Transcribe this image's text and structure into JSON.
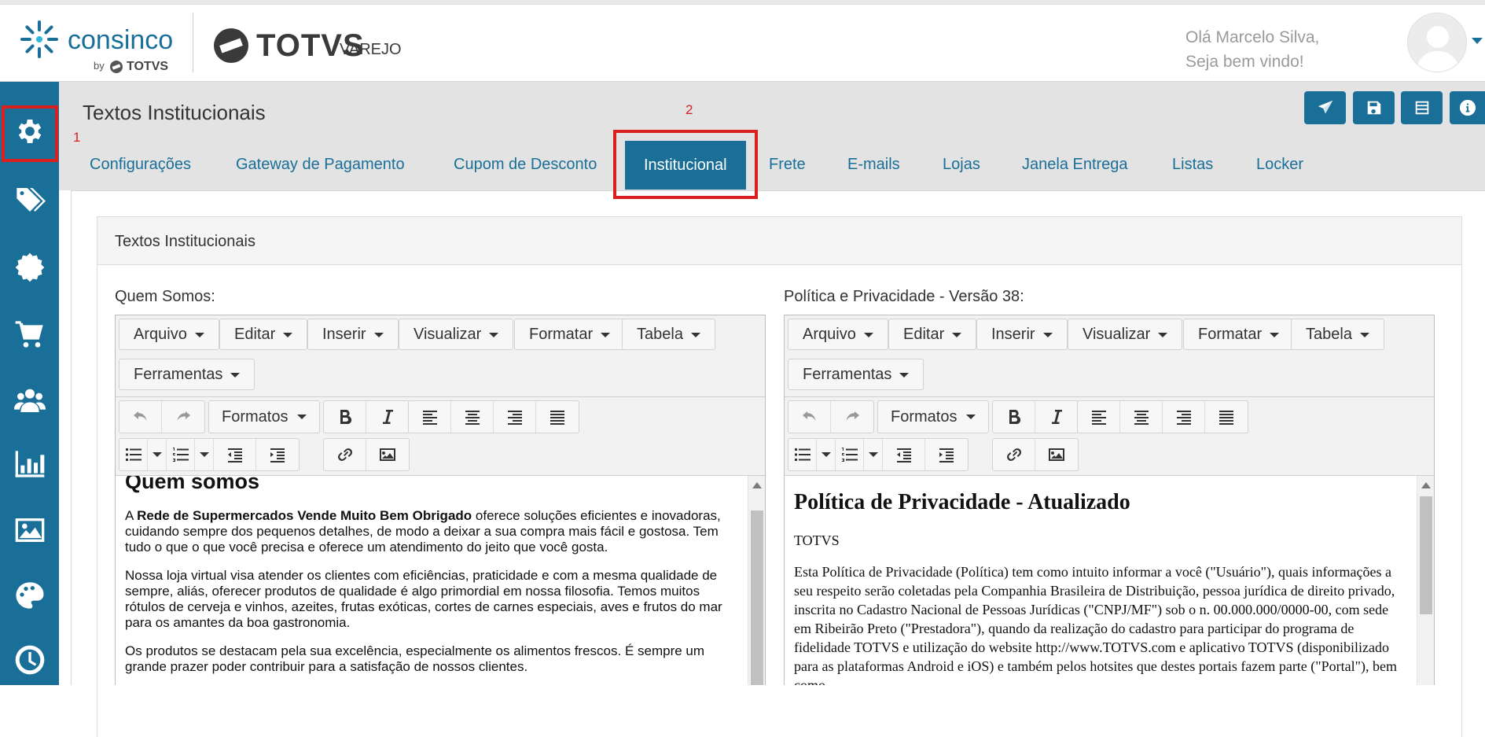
{
  "header": {
    "brand_name": "consinco",
    "brand_sub": "by",
    "brand_sub_logo": "TOTVS",
    "partner_logo": "TOTVS",
    "partner_logo_suffix": "VAREJO",
    "greeting_line1": "Olá Marcelo Silva,",
    "greeting_line2": "Seja bem vindo!"
  },
  "annotations": {
    "marker1": "1",
    "marker2": "2"
  },
  "sidebar": {
    "items": [
      {
        "icon": "gear-icon"
      },
      {
        "icon": "tags-icon"
      },
      {
        "icon": "badge-icon"
      },
      {
        "icon": "cart-icon"
      },
      {
        "icon": "users-icon"
      },
      {
        "icon": "bar-chart-icon"
      },
      {
        "icon": "image-icon"
      },
      {
        "icon": "palette-icon"
      },
      {
        "icon": "clock-icon"
      }
    ]
  },
  "page": {
    "title": "Textos Institucionais"
  },
  "tabs": [
    {
      "label": "Configurações"
    },
    {
      "label": "Gateway de Pagamento"
    },
    {
      "label": "Cupom de Desconto"
    },
    {
      "label": "Institucional"
    },
    {
      "label": "Frete"
    },
    {
      "label": "E-mails"
    },
    {
      "label": "Lojas"
    },
    {
      "label": "Janela Entrega"
    },
    {
      "label": "Listas"
    },
    {
      "label": "Locker"
    }
  ],
  "panel": {
    "heading": "Textos Institucionais"
  },
  "editors": {
    "left_label": "Quem Somos:",
    "right_label": "Política e Privacidade - Versão 38:",
    "menu": [
      "Arquivo",
      "Editar",
      "Inserir",
      "Visualizar",
      "Formatar",
      "Tabela",
      "Ferramentas"
    ],
    "formats_label": "Formatos"
  },
  "doc_left": {
    "heading": "Quem somos",
    "p1_pre": "A ",
    "p1_bold": "Rede de Supermercados Vende Muito Bem Obrigado",
    "p1_post": " oferece soluções eficientes e inovadoras, cuidando sempre dos pequenos detalhes, de modo a deixar a sua compra mais fácil e gostosa. Tem tudo o que o que você precisa e oferece um atendimento do jeito que você gosta.",
    "p2": "Nossa loja virtual visa atender os clientes com eficiências, praticidade e com a mesma qualidade de sempre, aliás, oferecer produtos de qualidade é algo primordial em nossa filosofia. Temos muitos rótulos de cerveja e vinhos, azeites, frutas exóticas, cortes de carnes especiais, aves e frutos do mar para os amantes da boa gastronomia.",
    "p3": "Os produtos se destacam pela sua excelência, especialmente os alimentos frescos. É sempre um grande prazer poder contribuir para a satisfação de nossos clientes."
  },
  "doc_right": {
    "heading": "Política de Privacidade - Atualizado",
    "p1": "TOTVS",
    "p2": "Esta Política de Privacidade (Política) tem como intuito informar a você (\"Usuário\"), quais informações a seu respeito serão coletadas pela Companhia Brasileira de Distribuição, pessoa jurídica de direito privado, inscrita no Cadastro Nacional de Pessoas Jurídicas (\"CNPJ/MF\") sob o n. 00.000.000/0000-00, com sede em Ribeirão Preto (\"Prestadora\"), quando da realização do cadastro para participar do programa de fidelidade TOTVS e utilização do website http://www.TOTVS.com e aplicativo TOTVS (disponibilizado para as plataformas Android e iOS) e também pelos hotsites que destes portais fazem parte (\"Portal\"), bem como"
  },
  "colors": {
    "primary": "#1a6f98",
    "highlight": "#d9201f",
    "title_bg": "#e3e3e3"
  }
}
